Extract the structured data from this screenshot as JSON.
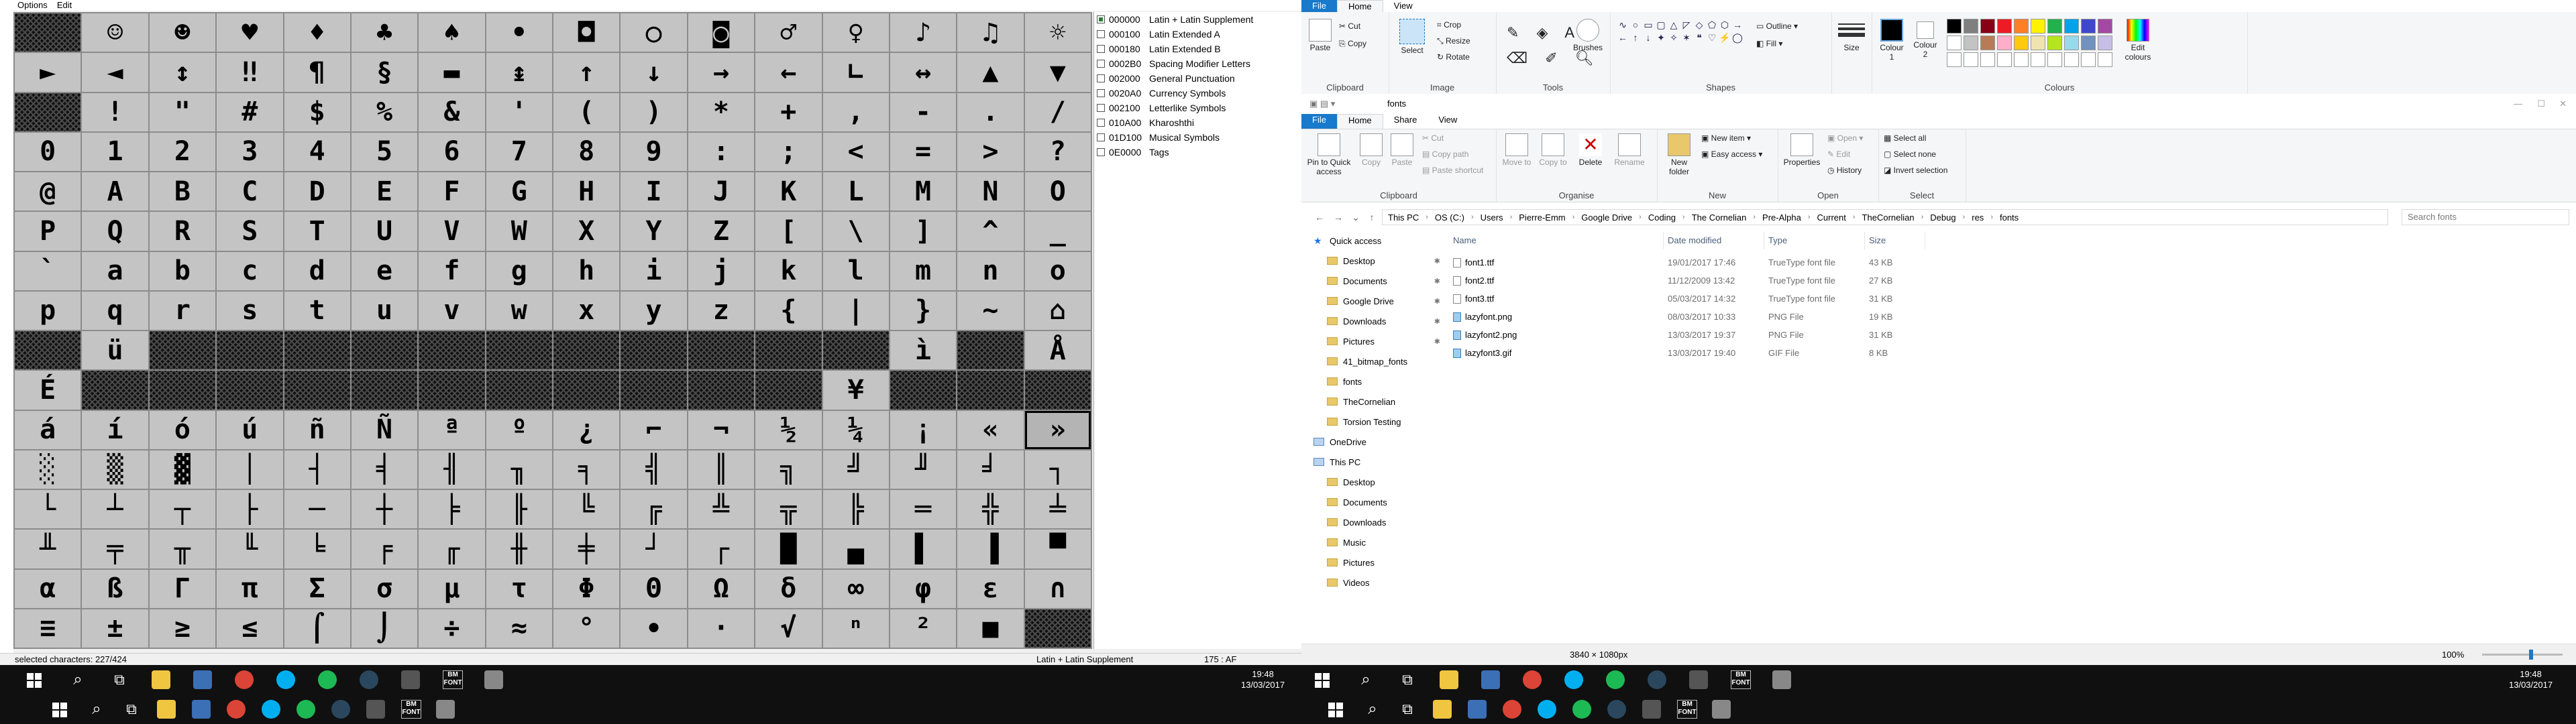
{
  "editor": {
    "menu": [
      "Options",
      "Edit"
    ],
    "grid_rows": [
      [
        "",
        "☺",
        "☻",
        "♥",
        "♦",
        "♣",
        "♠",
        "•",
        "◘",
        "○",
        "◙",
        "♂",
        "♀",
        "♪",
        "♫",
        "☼"
      ],
      [
        "►",
        "◄",
        "↕",
        "‼",
        "¶",
        "§",
        "▬",
        "↨",
        "↑",
        "↓",
        "→",
        "←",
        "∟",
        "↔",
        "▲",
        "▼"
      ],
      [
        "",
        "!",
        "\"",
        "#",
        "$",
        "%",
        "&",
        "'",
        "(",
        ")",
        "*",
        "+",
        ",",
        "-",
        ".",
        "/"
      ],
      [
        "0",
        "1",
        "2",
        "3",
        "4",
        "5",
        "6",
        "7",
        "8",
        "9",
        ":",
        ";",
        "<",
        "=",
        ">",
        "?"
      ],
      [
        "@",
        "A",
        "B",
        "C",
        "D",
        "E",
        "F",
        "G",
        "H",
        "I",
        "J",
        "K",
        "L",
        "M",
        "N",
        "O"
      ],
      [
        "P",
        "Q",
        "R",
        "S",
        "T",
        "U",
        "V",
        "W",
        "X",
        "Y",
        "Z",
        "[",
        "\\",
        "]",
        "^",
        "_"
      ],
      [
        "`",
        "a",
        "b",
        "c",
        "d",
        "e",
        "f",
        "g",
        "h",
        "i",
        "j",
        "k",
        "l",
        "m",
        "n",
        "o"
      ],
      [
        "p",
        "q",
        "r",
        "s",
        "t",
        "u",
        "v",
        "w",
        "x",
        "y",
        "z",
        "{",
        "|",
        "}",
        "~",
        "⌂"
      ],
      [
        "",
        "ü",
        "",
        "",
        "",
        "",
        "",
        "",
        "",
        "",
        "",
        "",
        "",
        "ì",
        "",
        "Å"
      ],
      [
        "É",
        "",
        "",
        "",
        "",
        "",
        "",
        "",
        "",
        "",
        "",
        "",
        "¥",
        "",
        "",
        ""
      ],
      [
        "á",
        "í",
        "ó",
        "ú",
        "ñ",
        "Ñ",
        "ª",
        "º",
        "¿",
        "⌐",
        "¬",
        "½",
        "¼",
        "¡",
        "«",
        "»"
      ],
      [
        "░",
        "▒",
        "▓",
        "│",
        "┤",
        "╡",
        "╢",
        "╖",
        "╕",
        "╣",
        "║",
        "╗",
        "╝",
        "╜",
        "╛",
        "┐"
      ],
      [
        "└",
        "┴",
        "┬",
        "├",
        "─",
        "┼",
        "╞",
        "╟",
        "╚",
        "╔",
        "╩",
        "╦",
        "╠",
        "═",
        "╬",
        "╧"
      ],
      [
        "╨",
        "╤",
        "╥",
        "╙",
        "╘",
        "╒",
        "╓",
        "╫",
        "╪",
        "┘",
        "┌",
        "█",
        "▄",
        "▌",
        "▐",
        "▀"
      ],
      [
        "α",
        "ß",
        "Γ",
        "π",
        "Σ",
        "σ",
        "µ",
        "τ",
        "Φ",
        "Θ",
        "Ω",
        "δ",
        "∞",
        "φ",
        "ε",
        "∩"
      ],
      [
        "≡",
        "±",
        "≥",
        "≤",
        "⌠",
        "⌡",
        "÷",
        "≈",
        "°",
        "∙",
        "·",
        "√",
        "ⁿ",
        "²",
        "■",
        ""
      ]
    ],
    "blank_cells": [
      [
        0,
        0
      ],
      [
        2,
        0
      ],
      [
        8,
        0
      ],
      [
        8,
        2
      ],
      [
        8,
        3
      ],
      [
        8,
        4
      ],
      [
        8,
        5
      ],
      [
        8,
        6
      ],
      [
        8,
        7
      ],
      [
        8,
        8
      ],
      [
        8,
        9
      ],
      [
        8,
        10
      ],
      [
        8,
        11
      ],
      [
        8,
        12
      ],
      [
        8,
        14
      ],
      [
        9,
        1
      ],
      [
        9,
        2
      ],
      [
        9,
        3
      ],
      [
        9,
        4
      ],
      [
        9,
        5
      ],
      [
        9,
        6
      ],
      [
        9,
        7
      ],
      [
        9,
        8
      ],
      [
        9,
        9
      ],
      [
        9,
        10
      ],
      [
        9,
        11
      ],
      [
        9,
        13
      ],
      [
        9,
        14
      ],
      [
        9,
        15
      ],
      [
        15,
        15
      ]
    ],
    "ranges": [
      {
        "code": "000000",
        "name": "Latin + Latin Supplement",
        "checked": true
      },
      {
        "code": "000100",
        "name": "Latin Extended A",
        "checked": false
      },
      {
        "code": "000180",
        "name": "Latin Extended B",
        "checked": false
      },
      {
        "code": "0002B0",
        "name": "Spacing Modifier Letters",
        "checked": false
      },
      {
        "code": "002000",
        "name": "General Punctuation",
        "checked": false
      },
      {
        "code": "0020A0",
        "name": "Currency Symbols",
        "checked": false
      },
      {
        "code": "002100",
        "name": "Letterlike Symbols",
        "checked": false
      },
      {
        "code": "010A00",
        "name": "Kharoshthi",
        "checked": false
      },
      {
        "code": "01D100",
        "name": "Musical Symbols",
        "checked": false
      },
      {
        "code": "0E0000",
        "name": "Tags",
        "checked": false
      }
    ],
    "status_left": "selected characters: 227/424",
    "status_mid": "Latin + Latin Supplement",
    "status_right": "175 : AF"
  },
  "paint": {
    "tabs": [
      "File",
      "Home",
      "View"
    ],
    "clipboard": {
      "paste": "Paste",
      "cut": "Cut",
      "copy": "Copy",
      "label": "Clipboard"
    },
    "image": {
      "select": "Select",
      "crop": "Crop",
      "resize": "Resize",
      "rotate": "Rotate",
      "label": "Image"
    },
    "tools_label": "Tools",
    "brushes": "Brushes",
    "shapes": {
      "outline": "Outline",
      "fill": "Fill",
      "label": "Shapes"
    },
    "size": "Size",
    "colour1": "Colour 1",
    "colour2": "Colour 2",
    "edit_colours": "Edit colours",
    "colours_label": "Colours",
    "palette": [
      "#000000",
      "#7f7f7f",
      "#880015",
      "#ed1c24",
      "#ff7f27",
      "#fff200",
      "#22b14c",
      "#00a2e8",
      "#3f48cc",
      "#a349a4",
      "#ffffff",
      "#c3c3c3",
      "#b97a57",
      "#ffaec9",
      "#ffc90e",
      "#efe4b0",
      "#b5e61d",
      "#99d9ea",
      "#7092be",
      "#c8bfe7"
    ]
  },
  "explorer": {
    "title": "fonts",
    "tabs": [
      "File",
      "Home",
      "Share",
      "View"
    ],
    "ribbon": {
      "clipboard": [
        "Pin to Quick access",
        "Copy",
        "Paste"
      ],
      "clip_small": [
        "Cut",
        "Copy path",
        "Paste shortcut"
      ],
      "clipboard_label": "Clipboard",
      "organise": [
        "Move to",
        "Copy to",
        "Delete",
        "Rename"
      ],
      "organise_label": "Organise",
      "new": [
        "New folder"
      ],
      "new_small": [
        "New item",
        "Easy access"
      ],
      "new_label": "New",
      "open": [
        "Properties"
      ],
      "open_small": [
        "Open",
        "Edit",
        "History"
      ],
      "open_label": "Open",
      "select_small": [
        "Select all",
        "Select none",
        "Invert selection"
      ],
      "select_label": "Select"
    },
    "breadcrumb": [
      "This PC",
      "OS (C:)",
      "Users",
      "Pierre-Emm",
      "Google Drive",
      "Coding",
      "The Cornelian",
      "Pre-Alpha",
      "Current",
      "TheCornelian",
      "Debug",
      "res",
      "fonts"
    ],
    "search_placeholder": "Search fonts",
    "nav": [
      {
        "label": "Quick access",
        "kind": "star",
        "indent": 0,
        "pinned": false
      },
      {
        "label": "Desktop",
        "kind": "folder",
        "indent": 1,
        "pinned": true
      },
      {
        "label": "Documents",
        "kind": "folder",
        "indent": 1,
        "pinned": true
      },
      {
        "label": "Google Drive",
        "kind": "folder",
        "indent": 1,
        "pinned": true
      },
      {
        "label": "Downloads",
        "kind": "folder",
        "indent": 1,
        "pinned": true
      },
      {
        "label": "Pictures",
        "kind": "folder",
        "indent": 1,
        "pinned": true
      },
      {
        "label": "41_bitmap_fonts",
        "kind": "folder",
        "indent": 1,
        "pinned": false
      },
      {
        "label": "fonts",
        "kind": "folder",
        "indent": 1,
        "pinned": false
      },
      {
        "label": "TheCornelian",
        "kind": "folder",
        "indent": 1,
        "pinned": false
      },
      {
        "label": "Torsion Testing",
        "kind": "folder",
        "indent": 1,
        "pinned": false
      },
      {
        "label": "OneDrive",
        "kind": "cloud",
        "indent": 0,
        "pinned": false
      },
      {
        "label": "This PC",
        "kind": "pc",
        "indent": 0,
        "pinned": false
      },
      {
        "label": "Desktop",
        "kind": "folder",
        "indent": 1,
        "pinned": false
      },
      {
        "label": "Documents",
        "kind": "folder",
        "indent": 1,
        "pinned": false
      },
      {
        "label": "Downloads",
        "kind": "folder",
        "indent": 1,
        "pinned": false
      },
      {
        "label": "Music",
        "kind": "folder",
        "indent": 1,
        "pinned": false
      },
      {
        "label": "Pictures",
        "kind": "folder",
        "indent": 1,
        "pinned": false
      },
      {
        "label": "Videos",
        "kind": "folder",
        "indent": 1,
        "pinned": false
      }
    ],
    "columns": [
      "Name",
      "Date modified",
      "Type",
      "Size"
    ],
    "files": [
      {
        "name": "font1.ttf",
        "date": "19/01/2017 17:46",
        "type": "TrueType font file",
        "size": "43 KB",
        "icon": "font"
      },
      {
        "name": "font2.ttf",
        "date": "11/12/2009 13:42",
        "type": "TrueType font file",
        "size": "27 KB",
        "icon": "font"
      },
      {
        "name": "font3.ttf",
        "date": "05/03/2017 14:32",
        "type": "TrueType font file",
        "size": "31 KB",
        "icon": "font"
      },
      {
        "name": "lazyfont.png",
        "date": "08/03/2017 10:33",
        "type": "PNG File",
        "size": "19 KB",
        "icon": "img"
      },
      {
        "name": "lazyfont2.png",
        "date": "13/03/2017 19:37",
        "type": "PNG File",
        "size": "31 KB",
        "icon": "img"
      },
      {
        "name": "lazyfont3.gif",
        "date": "13/03/2017 19:40",
        "type": "GIF File",
        "size": "8 KB",
        "icon": "img"
      }
    ],
    "status_dims": "3840 × 1080px",
    "zoom": "100%"
  },
  "taskbar": {
    "time": "19:48",
    "date": "13/03/2017",
    "font_app_label": "BM FONT"
  }
}
